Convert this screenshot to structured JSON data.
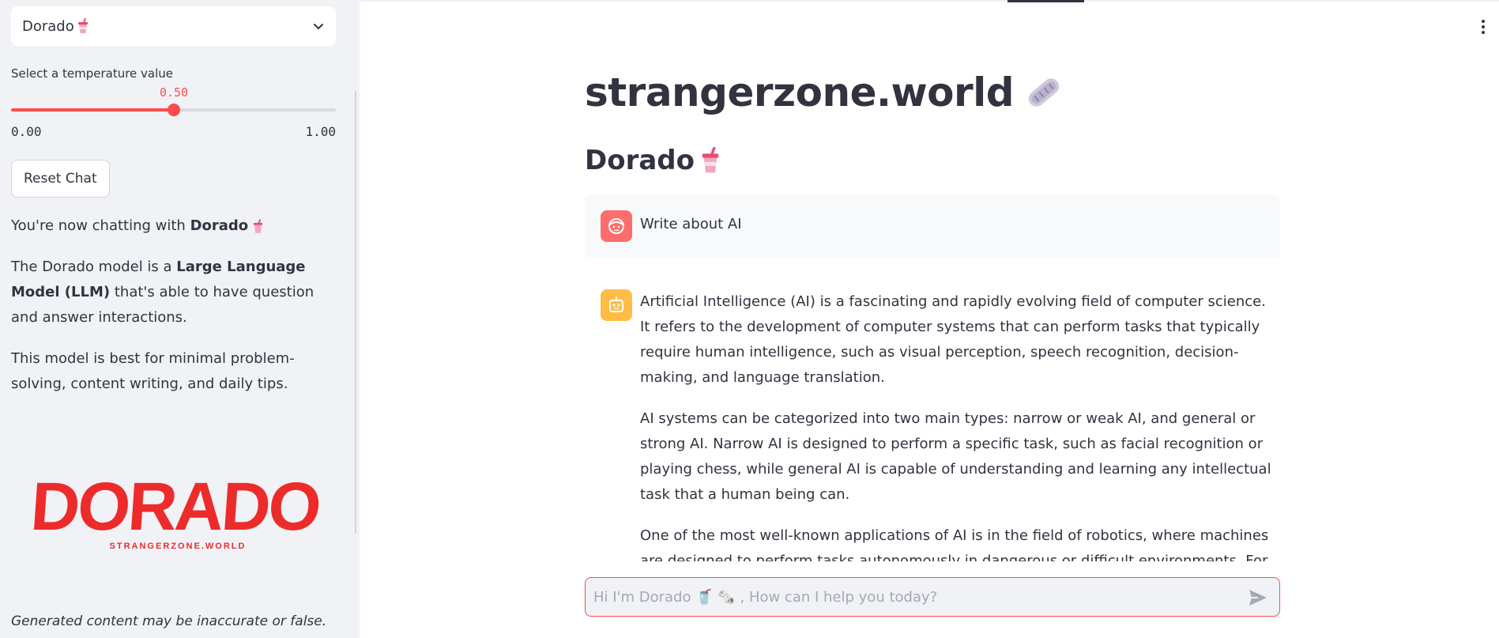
{
  "sidebar": {
    "model_select": {
      "value": "Dorado",
      "emoji": "🥤"
    },
    "temperature": {
      "label": "Select a temperature value",
      "value": "0.50",
      "min": "0.00",
      "max": "1.00",
      "fraction": 0.5
    },
    "reset_label": "Reset Chat",
    "chatting_prefix": "You're now chatting with ",
    "chatting_model": "Dorado",
    "description_prefix": "The Dorado model is a ",
    "description_bold": "Large Language Model (LLM)",
    "description_suffix": " that's able to have question and answer interactions.",
    "best_for": "This model is best for minimal problem-solving, content writing, and daily tips.",
    "logo_text": "DORADO",
    "logo_subtext": "STRANGERZONE.WORLD",
    "disclaimer": "Generated content may be inaccurate or false."
  },
  "main": {
    "title": "strangerzone.world",
    "subtitle": "Dorado",
    "user_message": "Write about AI",
    "bot_paragraphs": [
      "Artificial Intelligence (AI) is a fascinating and rapidly evolving field of computer science. It refers to the development of computer systems that can perform tasks that typically require human intelligence, such as visual perception, speech recognition, decision-making, and language translation.",
      "AI systems can be categorized into two main types: narrow or weak AI, and general or strong AI. Narrow AI is designed to perform a specific task, such as facial recognition or playing chess, while general AI is capable of understanding and learning any intellectual task that a human being can.",
      "One of the most well-known applications of AI is in the field of robotics, where machines are designed to perform tasks autonomously in dangerous or difficult environments. For example, robots are used in manufacturing to assemble products, in healthcare to assist in surgeries, and in"
    ],
    "chat_placeholder": "Hi I'm Dorado 🥤 🗞️ , How can I help you today?"
  },
  "icons": {
    "cup": "cup-with-straw-icon",
    "newspaper": "rolled-newspaper-icon",
    "user": "user-face-icon",
    "bot": "robot-icon",
    "send": "send-icon",
    "menu": "kebab-menu-icon"
  },
  "colors": {
    "accent": "#ff4b4b",
    "user_avatar": "#ff6c6c",
    "bot_avatar": "#ffbd45",
    "sidebar_bg": "#f0f2f6",
    "text": "#31333f"
  }
}
